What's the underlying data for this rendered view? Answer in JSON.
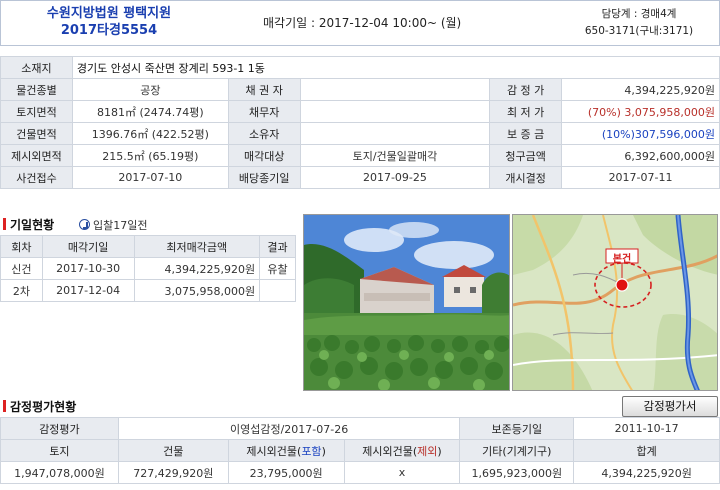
{
  "header": {
    "court": "수원지방법원 평택지원",
    "case_no": "2017타경5554",
    "auction_date": "매각기일 : 2017-12-04   10:00~ (월)",
    "dept": "담당계 : 경매4계",
    "phone": "650-3171(구내:3171)"
  },
  "property": {
    "location_label": "소재지",
    "location": "경기도 안성시 죽산면 장계리 593-1 1동",
    "type_label": "물건종별",
    "type": "공장",
    "creditor_label": "채 권 자",
    "creditor": "",
    "appraisal_label": "감 정 가",
    "appraisal": "4,394,225,920원",
    "land_area_label": "토지면적",
    "land_area": "8181㎡ (2474.74평)",
    "debtor_label": "채무자",
    "debtor": "",
    "min_price_label": "최 저 가",
    "min_price": "(70%) 3,075,958,000원",
    "bldg_area_label": "건물면적",
    "bldg_area": "1396.76㎡ (422.52평)",
    "owner_label": "소유자",
    "owner": "",
    "deposit_label": "보 증 금",
    "deposit": "(10%)307,596,000원",
    "excl_area_label": "제시외면적",
    "excl_area": "215.5㎡ (65.19평)",
    "sale_target_label": "매각대상",
    "sale_target": "토지/건물일괄매각",
    "claim_label": "청구금액",
    "claim": "6,392,600,000원",
    "filed_label": "사건접수",
    "filed": "2017-07-10",
    "dividend_label": "배당종기일",
    "dividend": "2017-09-25",
    "start_label": "개시결정",
    "start": "2017-07-11"
  },
  "history": {
    "title": "기일현황",
    "sub": "입찰17일전",
    "headers": [
      "회차",
      "매각기일",
      "최저매각금액",
      "결과"
    ],
    "rows": [
      {
        "round": "신건",
        "date": "2017-10-30",
        "price": "4,394,225,920원",
        "result": "유찰"
      },
      {
        "round": "2차",
        "date": "2017-12-04",
        "price": "3,075,958,000원",
        "result": ""
      }
    ]
  },
  "map": {
    "marker_label": "본건"
  },
  "appraisal": {
    "title": "감정평가현황",
    "button": "감정평가서",
    "agency_label": "감정평가",
    "agency": "이영섭감정/2017-07-26",
    "preserve_label": "보존등기일",
    "preserve": "2011-10-17",
    "h_land": "토지",
    "h_bldg": "건물",
    "h_incl_pre": "제시외건물(",
    "h_incl_mid": "포함",
    "h_excl_pre": "제시외건물(",
    "h_excl_mid": "제외",
    "h_paren": ")",
    "h_etc": "기타(기계기구)",
    "h_total": "합계",
    "v_land": "1,947,078,000원",
    "v_bldg": "727,429,920원",
    "v_incl": "23,795,000원",
    "v_excl": "x",
    "v_etc": "1,695,923,000원",
    "v_total": "4,394,225,920원"
  },
  "colors": {
    "label_bg": "#e8ebf0",
    "accent_red": "#b8302a",
    "accent_blue": "#1b43c0",
    "title_blue": "#1a3fb0"
  }
}
